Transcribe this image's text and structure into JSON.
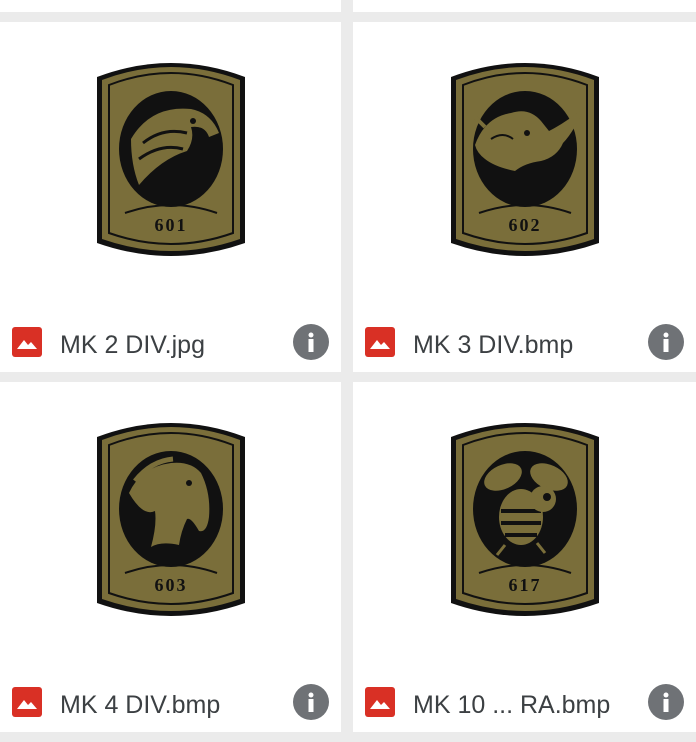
{
  "colors": {
    "page_background": "#ebebeb",
    "card_background": "#ffffff",
    "image_icon": "#d93025",
    "info_icon": "#6f7276",
    "badge_olive": "#7a6e3a",
    "badge_black": "#111111"
  },
  "files": [
    {
      "name": "MK 2 DIV.jpg",
      "badge_number": "601",
      "emblem": "eagle"
    },
    {
      "name": "MK 3 DIV.bmp",
      "badge_number": "602",
      "emblem": "rhino"
    },
    {
      "name": "MK 4 DIV.bmp",
      "badge_number": "603",
      "emblem": "horse"
    },
    {
      "name": "MK 10 ... RA.bmp",
      "badge_number": "617",
      "emblem": "hornet"
    }
  ],
  "icons": {
    "file_type": "image-icon",
    "details": "info-icon"
  }
}
